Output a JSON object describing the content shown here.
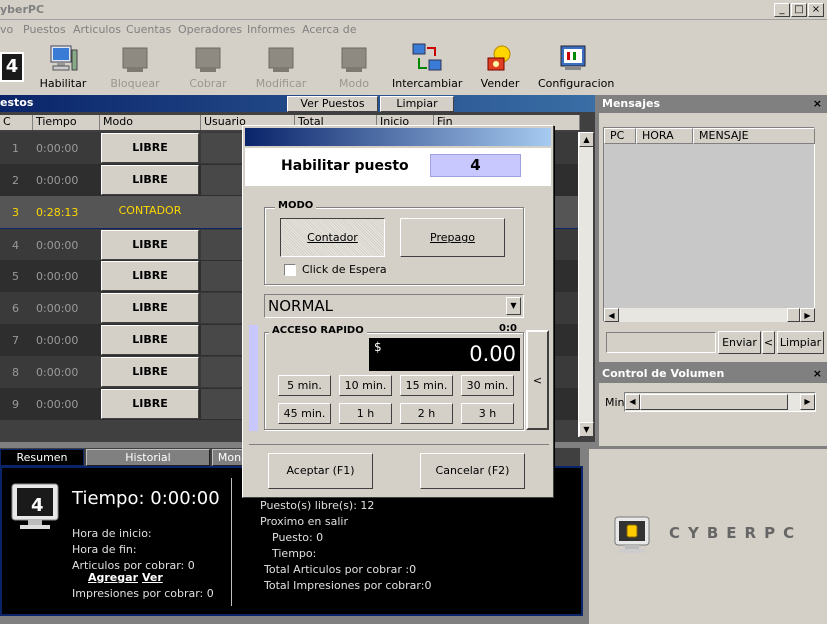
{
  "window": {
    "title": "yberPC",
    "min_label": "_",
    "max_label": "□",
    "close_label": "×"
  },
  "menu": [
    "vo",
    "Puestos",
    "Articulos",
    "Cuentas",
    "Operadores",
    "Informes",
    "Acerca de"
  ],
  "toolbar": {
    "counter": "4",
    "buttons": [
      {
        "label": "Habilitar",
        "icon": "computer-icon",
        "enabled": true
      },
      {
        "label": "Bloquear",
        "icon": "lock-icon",
        "enabled": false
      },
      {
        "label": "Cobrar",
        "icon": "cash-icon",
        "enabled": false
      },
      {
        "label": "Modificar",
        "icon": "edit-icon",
        "enabled": false
      },
      {
        "label": "Modo",
        "icon": "mode-icon",
        "enabled": false
      },
      {
        "label": "Intercambiar",
        "icon": "swap-icon",
        "enabled": true
      },
      {
        "label": "Vender",
        "icon": "sell-icon",
        "enabled": true
      },
      {
        "label": "Configuracion",
        "icon": "config-icon",
        "enabled": true
      }
    ]
  },
  "puestos": {
    "title": "estos",
    "ver_puestos": "Ver Puestos",
    "limpiar": "Limpiar",
    "columns": [
      "C",
      "Tiempo",
      "Modo",
      "Usuario",
      "Total",
      "Inicio",
      "Fin"
    ],
    "rows": [
      {
        "pc": "1",
        "tiempo": "0:00:00",
        "modo": "LIBRE",
        "active": false
      },
      {
        "pc": "2",
        "tiempo": "0:00:00",
        "modo": "LIBRE",
        "active": false
      },
      {
        "pc": "3",
        "tiempo": "0:28:13",
        "modo": "CONTADOR",
        "active": true
      },
      {
        "pc": "4",
        "tiempo": "0:00:00",
        "modo": "LIBRE",
        "active": false
      },
      {
        "pc": "5",
        "tiempo": "0:00:00",
        "modo": "LIBRE",
        "active": false
      },
      {
        "pc": "6",
        "tiempo": "0:00:00",
        "modo": "LIBRE",
        "active": false
      },
      {
        "pc": "7",
        "tiempo": "0:00:00",
        "modo": "LIBRE",
        "active": false
      },
      {
        "pc": "8",
        "tiempo": "0:00:00",
        "modo": "LIBRE",
        "active": false
      },
      {
        "pc": "9",
        "tiempo": "0:00:00",
        "modo": "LIBRE",
        "active": false
      }
    ]
  },
  "tabs": [
    "Resumen",
    "Historial",
    "Mon"
  ],
  "summary": {
    "pc_number": "4",
    "tiempo": "Tiempo: 0:00:00",
    "hora_inicio": "Hora de inicio:",
    "hora_fin": "Hora de fin:",
    "articulos": "Articulos por cobrar: 0",
    "agregar": "Agregar",
    "ver": "Ver",
    "impresiones": "Impresiones por cobrar: 0",
    "puestos_libres": "Puesto(s) libre(s): 12",
    "proximo": "Proximo en salir",
    "puesto": "Puesto: 0",
    "tiempo2": "Tiempo:",
    "total_articulos": "Total Articulos por cobrar  :0",
    "total_impresiones": "Total Impresiones por cobrar:0"
  },
  "mensajes": {
    "title": "Mensajes",
    "close": "×",
    "columns": [
      "PC",
      "HORA",
      "MENSAJE"
    ],
    "enviar": "Enviar",
    "back": "<",
    "limpiar": "Limpiar"
  },
  "volumen": {
    "title": "Control de Volumen",
    "close": "×",
    "min": "Min"
  },
  "brand": {
    "name": "CYBERPC"
  },
  "dialog": {
    "header": "Habilitar puesto",
    "pc_number": "4",
    "modo_label": "MODO",
    "contador": "Contador",
    "prepago": "Prepago",
    "click_espera": "Click de Espera",
    "tarifa": "NORMAL",
    "acceso_label": "ACCESO RAPIDO",
    "acceso_time": "0:0",
    "currency": "$",
    "amount": "0.00",
    "quick": [
      "5 min.",
      "10 min.",
      "15 min.",
      "30 min.",
      "45 min.",
      "1 h",
      "2 h",
      "3 h"
    ],
    "side_arrow": "<",
    "aceptar": "Aceptar (F1)",
    "cancelar": "Cancelar (F2)"
  },
  "colors": {
    "title_blue": "#0a246a",
    "highlight": "#ffd800",
    "lavender": "#c8c8ff"
  }
}
